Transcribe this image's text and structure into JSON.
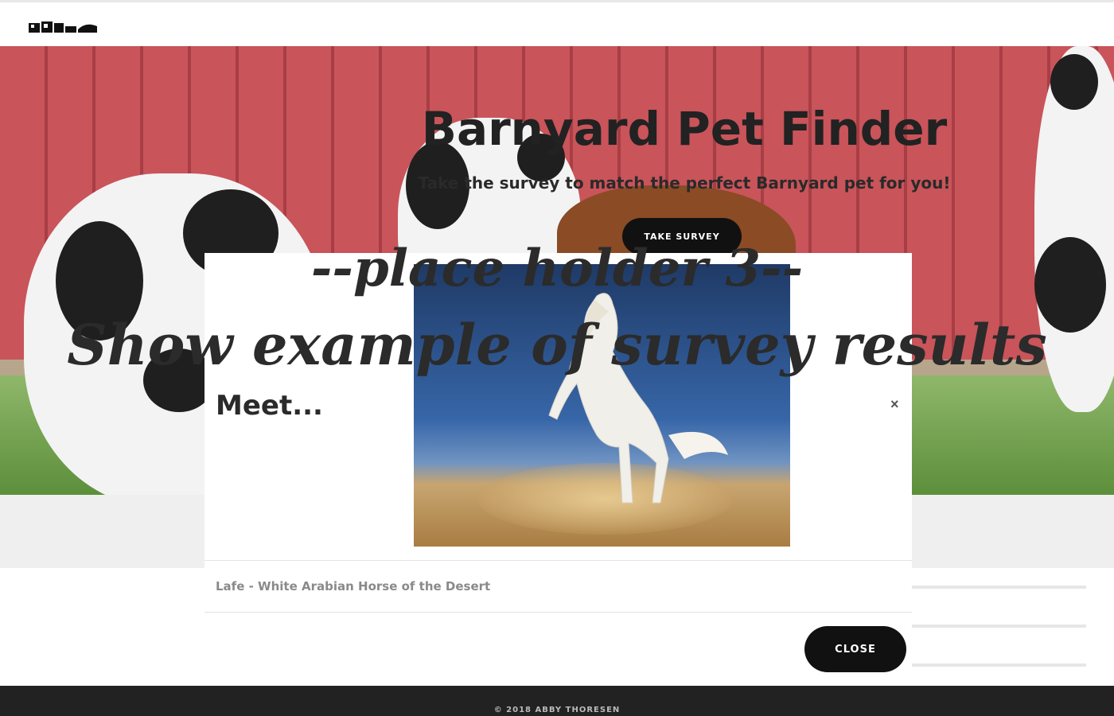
{
  "hero": {
    "title": "Barnyard Pet Finder",
    "subtitle": "Take the survey to match the perfect Barnyard pet for you!",
    "cta_label": "TAKE SURVEY"
  },
  "modal": {
    "title": "Meet...",
    "close_x": "×",
    "caption": "Lafe - White Arabian Horse of the Desert",
    "close_label": "CLOSE"
  },
  "placeholder": {
    "line1": "--place holder 3--",
    "line2": "Show example of survey results"
  },
  "footer": {
    "text": "© 2018 ABBY THORESEN"
  }
}
